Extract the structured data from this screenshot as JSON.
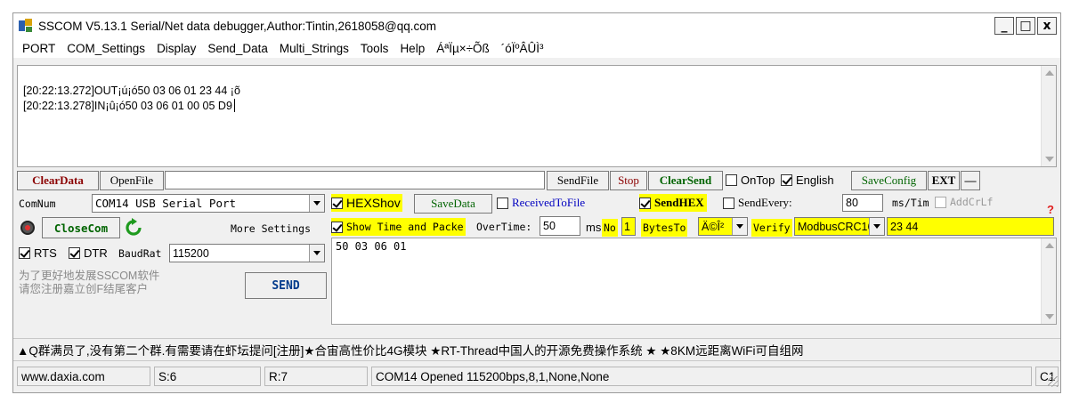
{
  "window": {
    "title": "SSCOM V5.13.1 Serial/Net data debugger,Author:Tintin,2618058@qq.com",
    "minimize": "_",
    "maximize": "□",
    "close": "x"
  },
  "menu": [
    "PORT",
    "COM_Settings",
    "Display",
    "Send_Data",
    "Multi_Strings",
    "Tools",
    "Help",
    "ÁªÏµ×÷Õß",
    "´óÏºÂÛÌ³"
  ],
  "receive": {
    "lines": [
      "[20:22:13.272]OUT¡ú¡ó50 03 06 01 23 44 ¡õ",
      "[20:22:13.278]IN¡û¡ó50 03 06 01 00 05 D9"
    ]
  },
  "toolbar": {
    "clear_data": "ClearData",
    "open_file": "OpenFile",
    "file_path": "",
    "send_file": "SendFile",
    "stop": "Stop",
    "clear_send": "ClearSend",
    "on_top": "OnTop",
    "english": "English",
    "save_config": "SaveConfig",
    "ext": "EXT",
    "collapse": "—"
  },
  "port": {
    "com_num_label": "ComNum",
    "com_port": "COM14 USB Serial Port",
    "close_com": "CloseCom",
    "more_settings": "More Settings",
    "rts": "RTS",
    "dtr": "DTR",
    "baud_label": "BaudRat",
    "baud": "115200",
    "promo_line1": "为了更好地发展SSCOM软件",
    "promo_line2": "请您注册嘉立创F结尾客户",
    "send_button": "SEND"
  },
  "options": {
    "hex_show": "HEXShov",
    "save_data": "SaveData",
    "received_to_file": "ReceivedToFile",
    "send_hex": "SendHEX",
    "send_every": "SendEvery:",
    "send_every_value": "80",
    "ms_tim": "ms/Tim",
    "add_crlf": "AddCrLf",
    "help_mark": "?",
    "show_time": "Show Time and Packe",
    "overtime": "OverTime:",
    "overtime_value": "50",
    "ms": "ms",
    "no": "No",
    "no_value": "1",
    "bytes_to": "BytesTo",
    "bytes_to_value": "Ä©Î²",
    "verify": "Verify",
    "verify_value": "ModbusCRC16",
    "crc_value": "23 44"
  },
  "send": {
    "text": "50 03 06 01"
  },
  "marquee": "▲Q群满员了,没有第二个群.有需要请在虾坛提问[注册]★合宙高性价比4G模块 ★RT-Thread中国人的开源免费操作系统 ★ ★8KM远距离WiFi可自组网",
  "status": {
    "website": "www.daxia.com",
    "sent": "S:6",
    "received": "R:7",
    "port_state": "COM14 Opened  115200bps,8,1,None,None",
    "col": "C1"
  },
  "colors": {
    "highlight": "#ffff00",
    "clear_data": "#8b0000",
    "clear_send": "#006400",
    "stop": "#8b0000",
    "save_config": "#006400"
  }
}
